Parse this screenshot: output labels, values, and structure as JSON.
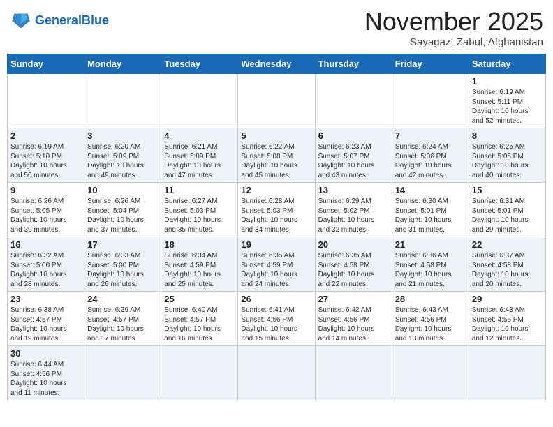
{
  "logo": {
    "text_general": "General",
    "text_blue": "Blue"
  },
  "header": {
    "month": "November 2025",
    "location": "Sayagaz, Zabul, Afghanistan"
  },
  "weekdays": [
    "Sunday",
    "Monday",
    "Tuesday",
    "Wednesday",
    "Thursday",
    "Friday",
    "Saturday"
  ],
  "rows": [
    {
      "style": "white",
      "cells": [
        {
          "day": "",
          "info": ""
        },
        {
          "day": "",
          "info": ""
        },
        {
          "day": "",
          "info": ""
        },
        {
          "day": "",
          "info": ""
        },
        {
          "day": "",
          "info": ""
        },
        {
          "day": "",
          "info": ""
        },
        {
          "day": "1",
          "info": "Sunrise: 6:19 AM\nSunset: 5:11 PM\nDaylight: 10 hours\nand 52 minutes."
        }
      ]
    },
    {
      "style": "gray",
      "cells": [
        {
          "day": "2",
          "info": "Sunrise: 6:19 AM\nSunset: 5:10 PM\nDaylight: 10 hours\nand 50 minutes."
        },
        {
          "day": "3",
          "info": "Sunrise: 6:20 AM\nSunset: 5:09 PM\nDaylight: 10 hours\nand 49 minutes."
        },
        {
          "day": "4",
          "info": "Sunrise: 6:21 AM\nSunset: 5:09 PM\nDaylight: 10 hours\nand 47 minutes."
        },
        {
          "day": "5",
          "info": "Sunrise: 6:22 AM\nSunset: 5:08 PM\nDaylight: 10 hours\nand 45 minutes."
        },
        {
          "day": "6",
          "info": "Sunrise: 6:23 AM\nSunset: 5:07 PM\nDaylight: 10 hours\nand 43 minutes."
        },
        {
          "day": "7",
          "info": "Sunrise: 6:24 AM\nSunset: 5:06 PM\nDaylight: 10 hours\nand 42 minutes."
        },
        {
          "day": "8",
          "info": "Sunrise: 6:25 AM\nSunset: 5:05 PM\nDaylight: 10 hours\nand 40 minutes."
        }
      ]
    },
    {
      "style": "white",
      "cells": [
        {
          "day": "9",
          "info": "Sunrise: 6:26 AM\nSunset: 5:05 PM\nDaylight: 10 hours\nand 39 minutes."
        },
        {
          "day": "10",
          "info": "Sunrise: 6:26 AM\nSunset: 5:04 PM\nDaylight: 10 hours\nand 37 minutes."
        },
        {
          "day": "11",
          "info": "Sunrise: 6:27 AM\nSunset: 5:03 PM\nDaylight: 10 hours\nand 35 minutes."
        },
        {
          "day": "12",
          "info": "Sunrise: 6:28 AM\nSunset: 5:03 PM\nDaylight: 10 hours\nand 34 minutes."
        },
        {
          "day": "13",
          "info": "Sunrise: 6:29 AM\nSunset: 5:02 PM\nDaylight: 10 hours\nand 32 minutes."
        },
        {
          "day": "14",
          "info": "Sunrise: 6:30 AM\nSunset: 5:01 PM\nDaylight: 10 hours\nand 31 minutes."
        },
        {
          "day": "15",
          "info": "Sunrise: 6:31 AM\nSunset: 5:01 PM\nDaylight: 10 hours\nand 29 minutes."
        }
      ]
    },
    {
      "style": "gray",
      "cells": [
        {
          "day": "16",
          "info": "Sunrise: 6:32 AM\nSunset: 5:00 PM\nDaylight: 10 hours\nand 28 minutes."
        },
        {
          "day": "17",
          "info": "Sunrise: 6:33 AM\nSunset: 5:00 PM\nDaylight: 10 hours\nand 26 minutes."
        },
        {
          "day": "18",
          "info": "Sunrise: 6:34 AM\nSunset: 4:59 PM\nDaylight: 10 hours\nand 25 minutes."
        },
        {
          "day": "19",
          "info": "Sunrise: 6:35 AM\nSunset: 4:59 PM\nDaylight: 10 hours\nand 24 minutes."
        },
        {
          "day": "20",
          "info": "Sunrise: 6:35 AM\nSunset: 4:58 PM\nDaylight: 10 hours\nand 22 minutes."
        },
        {
          "day": "21",
          "info": "Sunrise: 6:36 AM\nSunset: 4:58 PM\nDaylight: 10 hours\nand 21 minutes."
        },
        {
          "day": "22",
          "info": "Sunrise: 6:37 AM\nSunset: 4:58 PM\nDaylight: 10 hours\nand 20 minutes."
        }
      ]
    },
    {
      "style": "white",
      "cells": [
        {
          "day": "23",
          "info": "Sunrise: 6:38 AM\nSunset: 4:57 PM\nDaylight: 10 hours\nand 19 minutes."
        },
        {
          "day": "24",
          "info": "Sunrise: 6:39 AM\nSunset: 4:57 PM\nDaylight: 10 hours\nand 17 minutes."
        },
        {
          "day": "25",
          "info": "Sunrise: 6:40 AM\nSunset: 4:57 PM\nDaylight: 10 hours\nand 16 minutes."
        },
        {
          "day": "26",
          "info": "Sunrise: 6:41 AM\nSunset: 4:56 PM\nDaylight: 10 hours\nand 15 minutes."
        },
        {
          "day": "27",
          "info": "Sunrise: 6:42 AM\nSunset: 4:56 PM\nDaylight: 10 hours\nand 14 minutes."
        },
        {
          "day": "28",
          "info": "Sunrise: 6:43 AM\nSunset: 4:56 PM\nDaylight: 10 hours\nand 13 minutes."
        },
        {
          "day": "29",
          "info": "Sunrise: 6:43 AM\nSunset: 4:56 PM\nDaylight: 10 hours\nand 12 minutes."
        }
      ]
    },
    {
      "style": "gray",
      "cells": [
        {
          "day": "30",
          "info": "Sunrise: 6:44 AM\nSunset: 4:56 PM\nDaylight: 10 hours\nand 11 minutes."
        },
        {
          "day": "",
          "info": ""
        },
        {
          "day": "",
          "info": ""
        },
        {
          "day": "",
          "info": ""
        },
        {
          "day": "",
          "info": ""
        },
        {
          "day": "",
          "info": ""
        },
        {
          "day": "",
          "info": ""
        }
      ]
    }
  ]
}
